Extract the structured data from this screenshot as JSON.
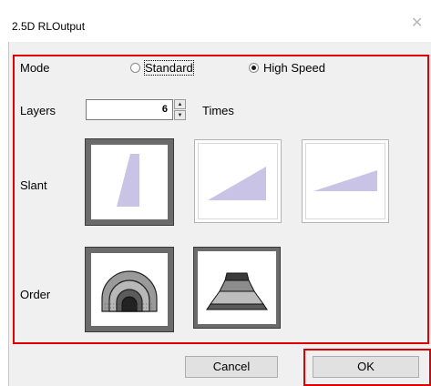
{
  "window": {
    "title": "2.5D RLOutput",
    "close_icon": "close-icon"
  },
  "mode": {
    "label": "Mode",
    "options": [
      {
        "label": "Standard",
        "selected": false
      },
      {
        "label": "High Speed",
        "selected": true
      }
    ]
  },
  "layers": {
    "label": "Layers",
    "value": "6",
    "unit": "Times"
  },
  "slant": {
    "label": "Slant",
    "options": [
      {
        "name": "steep",
        "selected": true
      },
      {
        "name": "medium",
        "selected": false
      },
      {
        "name": "shallow",
        "selected": false
      }
    ],
    "shape_color": "#c9c4e6"
  },
  "order": {
    "label": "Order",
    "options": [
      {
        "name": "outer-first",
        "selected": true
      },
      {
        "name": "top-first",
        "selected": false
      }
    ]
  },
  "buttons": {
    "cancel": "Cancel",
    "ok": "OK"
  },
  "colors": {
    "highlight": "#e00000",
    "dialog_bg": "#f0f0f0"
  }
}
